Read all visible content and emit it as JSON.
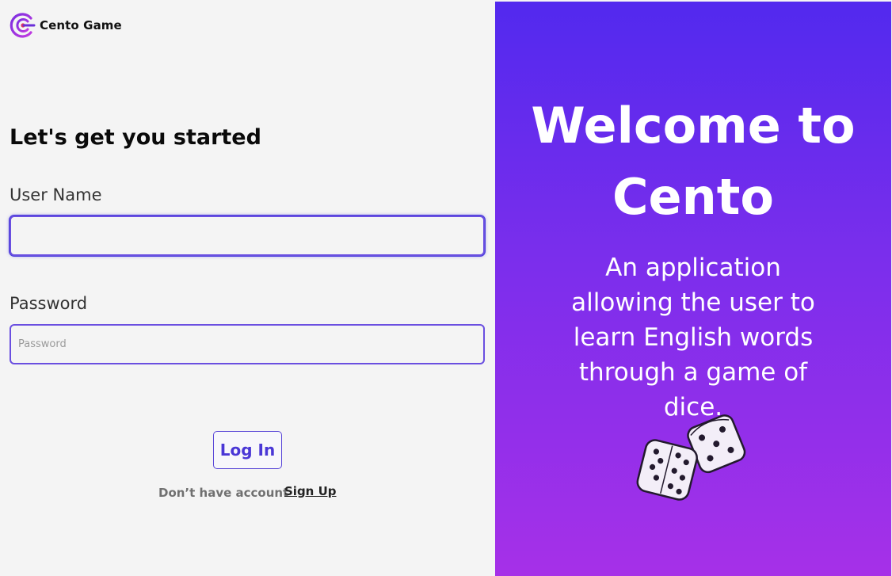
{
  "app": {
    "name": "Cento Game",
    "logo_icon": "cento-c-logo-icon"
  },
  "login": {
    "heading": "Let's get you started",
    "username_label": "User Name",
    "username_value": "",
    "username_placeholder": "",
    "password_label": "Password",
    "password_value": "",
    "password_placeholder": "Password",
    "login_button": "Log In",
    "no_account_text": "Don’t have account",
    "signup_link": "Sign Up"
  },
  "hero": {
    "title": "Welcome to Cento",
    "description": "An application allowing the user to learn English words through a game of dice.",
    "illustration_icon": "dice-icon"
  },
  "colors": {
    "accent": "#4a37d6",
    "gradient_top": "#5229ee",
    "gradient_bottom": "#a630e8",
    "field_border": "#6a4fe0"
  }
}
